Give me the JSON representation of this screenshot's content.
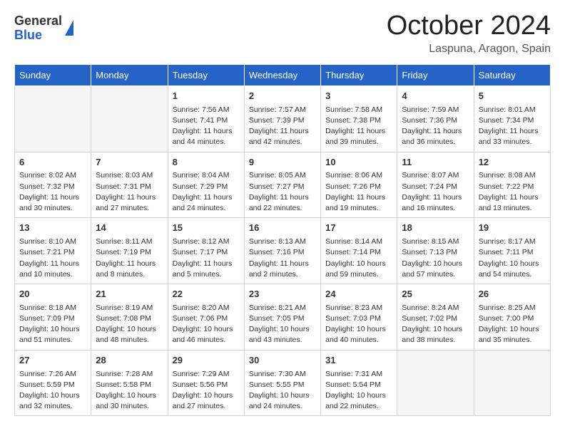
{
  "logo": {
    "general": "General",
    "blue": "Blue"
  },
  "header": {
    "month": "October 2024",
    "location": "Laspuna, Aragon, Spain"
  },
  "weekdays": [
    "Sunday",
    "Monday",
    "Tuesday",
    "Wednesday",
    "Thursday",
    "Friday",
    "Saturday"
  ],
  "weeks": [
    [
      {
        "day": "",
        "sunrise": "",
        "sunset": "",
        "daylight": ""
      },
      {
        "day": "",
        "sunrise": "",
        "sunset": "",
        "daylight": ""
      },
      {
        "day": "1",
        "sunrise": "Sunrise: 7:56 AM",
        "sunset": "Sunset: 7:41 PM",
        "daylight": "Daylight: 11 hours and 44 minutes."
      },
      {
        "day": "2",
        "sunrise": "Sunrise: 7:57 AM",
        "sunset": "Sunset: 7:39 PM",
        "daylight": "Daylight: 11 hours and 42 minutes."
      },
      {
        "day": "3",
        "sunrise": "Sunrise: 7:58 AM",
        "sunset": "Sunset: 7:38 PM",
        "daylight": "Daylight: 11 hours and 39 minutes."
      },
      {
        "day": "4",
        "sunrise": "Sunrise: 7:59 AM",
        "sunset": "Sunset: 7:36 PM",
        "daylight": "Daylight: 11 hours and 36 minutes."
      },
      {
        "day": "5",
        "sunrise": "Sunrise: 8:01 AM",
        "sunset": "Sunset: 7:34 PM",
        "daylight": "Daylight: 11 hours and 33 minutes."
      }
    ],
    [
      {
        "day": "6",
        "sunrise": "Sunrise: 8:02 AM",
        "sunset": "Sunset: 7:32 PM",
        "daylight": "Daylight: 11 hours and 30 minutes."
      },
      {
        "day": "7",
        "sunrise": "Sunrise: 8:03 AM",
        "sunset": "Sunset: 7:31 PM",
        "daylight": "Daylight: 11 hours and 27 minutes."
      },
      {
        "day": "8",
        "sunrise": "Sunrise: 8:04 AM",
        "sunset": "Sunset: 7:29 PM",
        "daylight": "Daylight: 11 hours and 24 minutes."
      },
      {
        "day": "9",
        "sunrise": "Sunrise: 8:05 AM",
        "sunset": "Sunset: 7:27 PM",
        "daylight": "Daylight: 11 hours and 22 minutes."
      },
      {
        "day": "10",
        "sunrise": "Sunrise: 8:06 AM",
        "sunset": "Sunset: 7:26 PM",
        "daylight": "Daylight: 11 hours and 19 minutes."
      },
      {
        "day": "11",
        "sunrise": "Sunrise: 8:07 AM",
        "sunset": "Sunset: 7:24 PM",
        "daylight": "Daylight: 11 hours and 16 minutes."
      },
      {
        "day": "12",
        "sunrise": "Sunrise: 8:08 AM",
        "sunset": "Sunset: 7:22 PM",
        "daylight": "Daylight: 11 hours and 13 minutes."
      }
    ],
    [
      {
        "day": "13",
        "sunrise": "Sunrise: 8:10 AM",
        "sunset": "Sunset: 7:21 PM",
        "daylight": "Daylight: 11 hours and 10 minutes."
      },
      {
        "day": "14",
        "sunrise": "Sunrise: 8:11 AM",
        "sunset": "Sunset: 7:19 PM",
        "daylight": "Daylight: 11 hours and 8 minutes."
      },
      {
        "day": "15",
        "sunrise": "Sunrise: 8:12 AM",
        "sunset": "Sunset: 7:17 PM",
        "daylight": "Daylight: 11 hours and 5 minutes."
      },
      {
        "day": "16",
        "sunrise": "Sunrise: 8:13 AM",
        "sunset": "Sunset: 7:16 PM",
        "daylight": "Daylight: 11 hours and 2 minutes."
      },
      {
        "day": "17",
        "sunrise": "Sunrise: 8:14 AM",
        "sunset": "Sunset: 7:14 PM",
        "daylight": "Daylight: 10 hours and 59 minutes."
      },
      {
        "day": "18",
        "sunrise": "Sunrise: 8:15 AM",
        "sunset": "Sunset: 7:13 PM",
        "daylight": "Daylight: 10 hours and 57 minutes."
      },
      {
        "day": "19",
        "sunrise": "Sunrise: 8:17 AM",
        "sunset": "Sunset: 7:11 PM",
        "daylight": "Daylight: 10 hours and 54 minutes."
      }
    ],
    [
      {
        "day": "20",
        "sunrise": "Sunrise: 8:18 AM",
        "sunset": "Sunset: 7:09 PM",
        "daylight": "Daylight: 10 hours and 51 minutes."
      },
      {
        "day": "21",
        "sunrise": "Sunrise: 8:19 AM",
        "sunset": "Sunset: 7:08 PM",
        "daylight": "Daylight: 10 hours and 48 minutes."
      },
      {
        "day": "22",
        "sunrise": "Sunrise: 8:20 AM",
        "sunset": "Sunset: 7:06 PM",
        "daylight": "Daylight: 10 hours and 46 minutes."
      },
      {
        "day": "23",
        "sunrise": "Sunrise: 8:21 AM",
        "sunset": "Sunset: 7:05 PM",
        "daylight": "Daylight: 10 hours and 43 minutes."
      },
      {
        "day": "24",
        "sunrise": "Sunrise: 8:23 AM",
        "sunset": "Sunset: 7:03 PM",
        "daylight": "Daylight: 10 hours and 40 minutes."
      },
      {
        "day": "25",
        "sunrise": "Sunrise: 8:24 AM",
        "sunset": "Sunset: 7:02 PM",
        "daylight": "Daylight: 10 hours and 38 minutes."
      },
      {
        "day": "26",
        "sunrise": "Sunrise: 8:25 AM",
        "sunset": "Sunset: 7:00 PM",
        "daylight": "Daylight: 10 hours and 35 minutes."
      }
    ],
    [
      {
        "day": "27",
        "sunrise": "Sunrise: 7:26 AM",
        "sunset": "Sunset: 5:59 PM",
        "daylight": "Daylight: 10 hours and 32 minutes."
      },
      {
        "day": "28",
        "sunrise": "Sunrise: 7:28 AM",
        "sunset": "Sunset: 5:58 PM",
        "daylight": "Daylight: 10 hours and 30 minutes."
      },
      {
        "day": "29",
        "sunrise": "Sunrise: 7:29 AM",
        "sunset": "Sunset: 5:56 PM",
        "daylight": "Daylight: 10 hours and 27 minutes."
      },
      {
        "day": "30",
        "sunrise": "Sunrise: 7:30 AM",
        "sunset": "Sunset: 5:55 PM",
        "daylight": "Daylight: 10 hours and 24 minutes."
      },
      {
        "day": "31",
        "sunrise": "Sunrise: 7:31 AM",
        "sunset": "Sunset: 5:54 PM",
        "daylight": "Daylight: 10 hours and 22 minutes."
      },
      {
        "day": "",
        "sunrise": "",
        "sunset": "",
        "daylight": ""
      },
      {
        "day": "",
        "sunrise": "",
        "sunset": "",
        "daylight": ""
      }
    ]
  ]
}
